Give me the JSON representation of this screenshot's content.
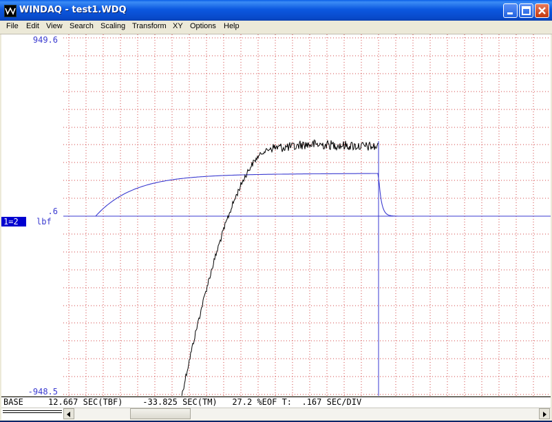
{
  "window": {
    "title": "WINDAQ - test1.WDQ",
    "app_icon": "windaq-app-icon",
    "controls": [
      "minimize-icon",
      "maximize-icon",
      "close-icon"
    ]
  },
  "menu": [
    "File",
    "Edit",
    "View",
    "Search",
    "Scaling",
    "Transform",
    "XY",
    "Options",
    "Help"
  ],
  "plot": {
    "y_top_label": "949.6",
    "y_mid_label": ".6",
    "y_bottom_label": "-948.5",
    "channel_tag": "1=2",
    "unit_label": "lbf",
    "colors": {
      "grid": "#d04040",
      "channel_black": "#000000",
      "channel_blue": "#3a3ad0",
      "label": "#3a3ad0",
      "tag_bg": "#0000d0"
    }
  },
  "status": {
    "text": "BASE     12.667 SEC(TBF)    -33.825 SEC(TM)   27.2 %EOF T:  .167 SEC/DIV"
  },
  "scrollbar": {
    "left_arrow": "left-arrow-icon",
    "right_arrow": "right-arrow-icon"
  }
}
